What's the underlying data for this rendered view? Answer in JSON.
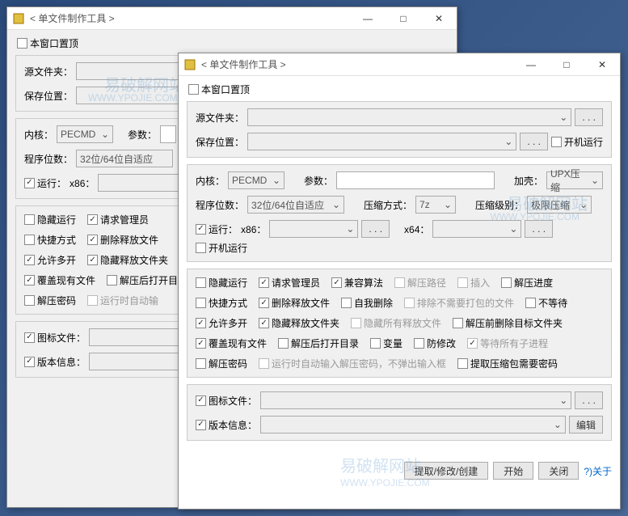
{
  "app": {
    "title": "< 单文件制作工具 >"
  },
  "winbtns": {
    "min": "—",
    "max": "□",
    "close": "✕"
  },
  "top": {
    "pin": "本窗口置顶"
  },
  "labels": {
    "source_folder": "源文件夹：",
    "save_location": "保存位置：",
    "kernel": "内核：",
    "params": "参数：",
    "shell": "加壳：",
    "arch": "程序位数：",
    "compress_method": "压缩方式：",
    "compress_level": "压缩级别：",
    "run": "运行：",
    "x86": "x86：",
    "x64": "x64：",
    "icon_file": "图标文件：",
    "version_info": "版本信息："
  },
  "values": {
    "kernel": "PECMD",
    "shell": "UPX压缩",
    "arch": "32位/64位自适应",
    "compress_method": "7z",
    "compress_level": "极限压缩",
    "ellipsis": ". . .",
    "edit": "编辑"
  },
  "checks": {
    "boot_run": "开机运行",
    "hidden_run": "隐藏运行",
    "req_admin": "请求管理员",
    "compat_algo": "兼容算法",
    "unzip_path": "解压路径",
    "insert": "插入",
    "unzip_progress": "解压进度",
    "shortcut": "快捷方式",
    "del_extract": "删除释放文件",
    "self_delete": "自我删除",
    "exclude_files": "排除不需要打包的文件",
    "no_wait": "不等待",
    "allow_multi": "允许多开",
    "hide_extract_folder": "隐藏释放文件夹",
    "hide_all_extract": "隐藏所有释放文件",
    "del_target_before": "解压前删除目标文件夹",
    "overwrite": "覆盖现有文件",
    "open_after": "解压后打开目录",
    "variable": "变量",
    "anti_modify": "防修改",
    "wait_children": "等待所有子进程",
    "unzip_pwd": "解压密码",
    "auto_pwd": "运行时自动输入解压密码，不弹出输入框",
    "hint_pkg_pwd": "提取压缩包需要密码"
  },
  "bottom": {
    "extract": "提取/修改/创建",
    "start": "开始",
    "close": "关闭",
    "about": "?)关于"
  },
  "watermark": {
    "main": "易破解网站",
    "sub": "WWW.YPOJIE.COM"
  }
}
